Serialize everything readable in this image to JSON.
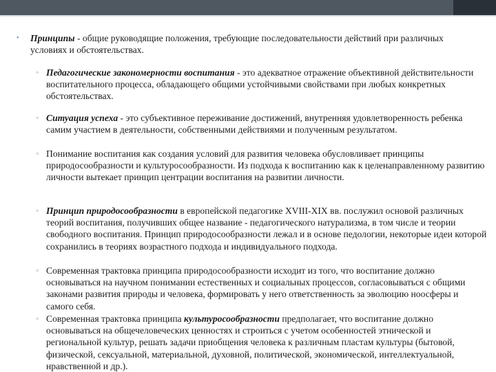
{
  "items": [
    {
      "term": "Принципы",
      "text": " - общие руководящие положения, требующие последовательности действий при различных условиях и обстоятельствах."
    },
    {
      "term": "Педагогические закономерности воспитания",
      "text": " - это адекватное отражение объективной действительности воспитательного процесса, обладающего общими устойчивыми свойствами при любых конкретных обстоятельствах."
    },
    {
      "term": "Ситуация успеха",
      "text": " - это субъективное переживание достижений, внутренняя удовлетворенность ребенка самим участием в деятельности, собственными действиями и полученным результатом."
    },
    {
      "text": "Понимание воспитания как создания условий для развития человека обусловливает принципы природосообразности и культуросообразности. Из подхода к воспитанию как к целенаправленному развитию личности вытекает принцип центрации воспитания на развитии личности."
    },
    {
      "term": "Принцип природосообразности",
      "text": " в европейской педагогике XVIII-XIX вв. послужил основой различных теорий воспитания, получивших общее название - педагогического натурализма, в том числе и теории свободного воспитания. Принцип природосообразности лежал и в основе педологии, некоторые идеи которой сохранились в теориях возрастного подхода и индивидуального подхода."
    },
    {
      "text": "Современная трактовка принципа природосообразности исходит из того, что воспитание должно основываться на научном понимании естественных и социальных процессов, согласовываться с общими законами развития природы и человека, формировать у него ответственность за эволюцию ноосферы и самого себя."
    },
    {
      "before": "Современная трактовка принципа ",
      "term": "культуросообразности",
      "text": " предполагает, что воспитание должно основываться на общечеловеческих ценностях и строиться с учетом особенностей этнической и региональной культур, решать задачи приобщения человека к различным пластам культуры (бытовой, физической, сексуальной, материальной, духовной, политической, экономической, интеллектуальной, нравственной и др.)."
    }
  ],
  "bullets": {
    "level1": "•",
    "level2": "◦"
  }
}
